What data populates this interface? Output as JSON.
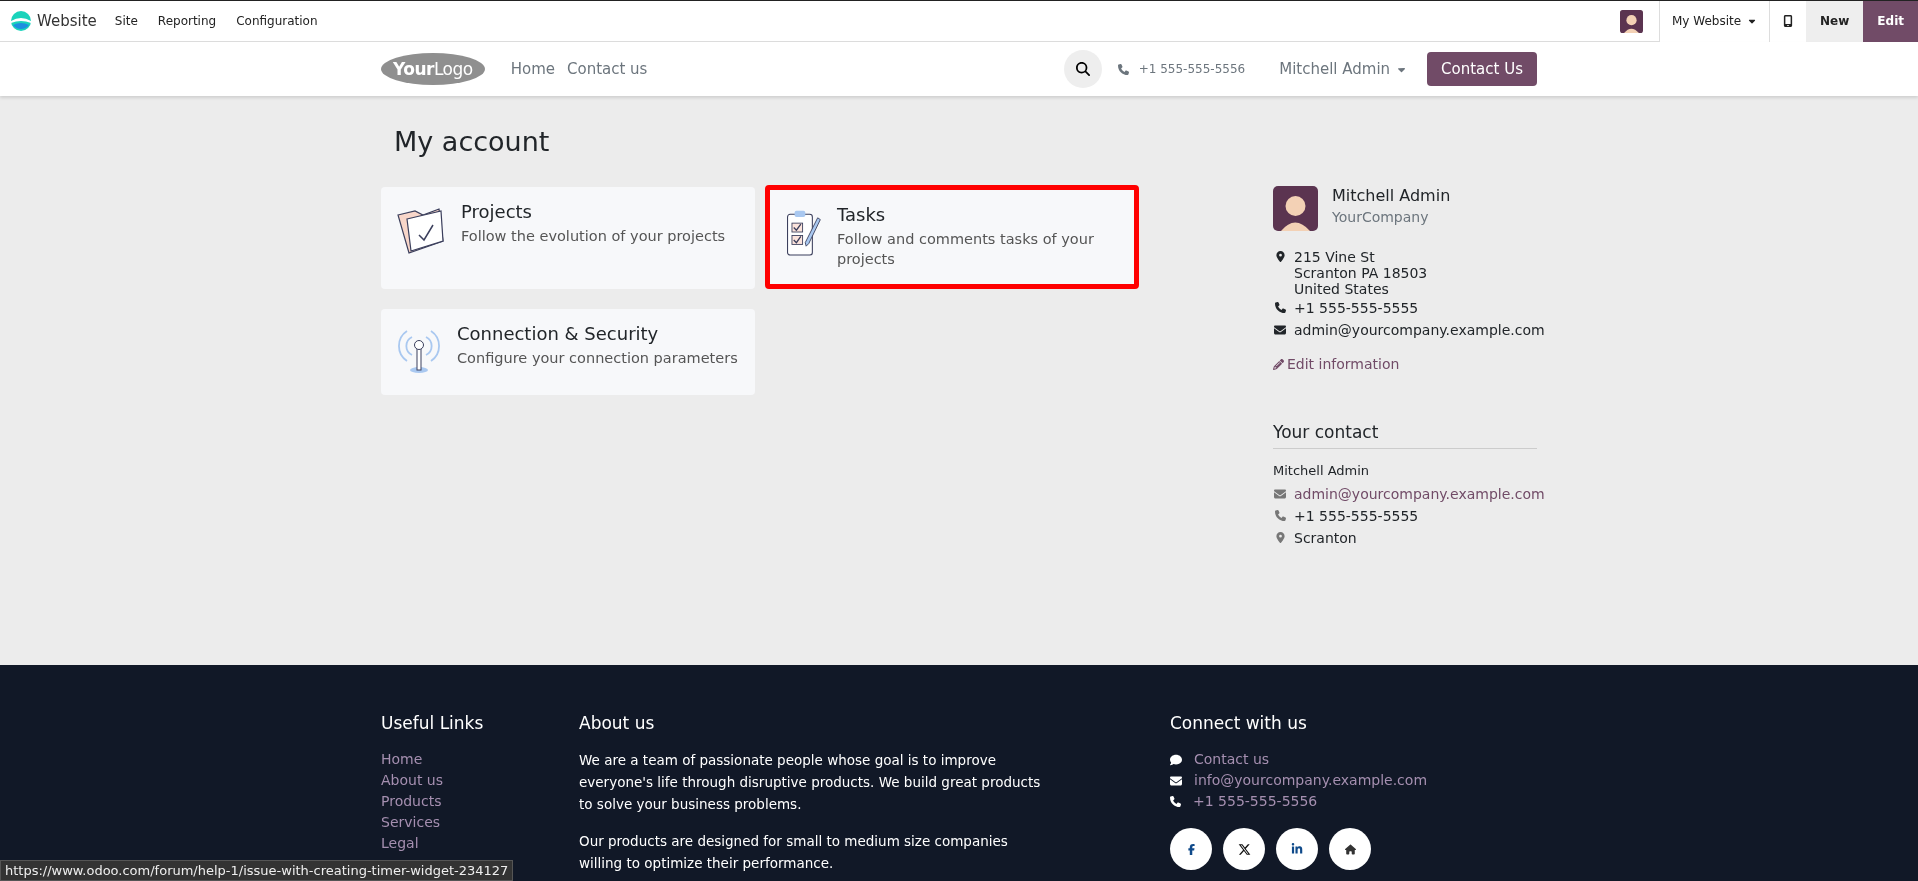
{
  "admin_bar": {
    "app_name": "Website",
    "menu": [
      "Site",
      "Reporting",
      "Configuration"
    ],
    "website_switch": "My Website",
    "new_button": "New",
    "edit_button": "Edit"
  },
  "header": {
    "logo": "**Your**Logo",
    "nav": [
      "Home",
      "Contact us"
    ],
    "phone": "+1 555-555-5556",
    "user": "Mitchell Admin",
    "cta": "Contact Us"
  },
  "page_title": "My account",
  "cards": [
    {
      "title": "Projects",
      "description": "Follow the evolution of your projects",
      "kind": "folder",
      "highlighted": false
    },
    {
      "title": "Tasks",
      "description": "Follow and comments tasks of your projects",
      "kind": "tasks",
      "highlighted": true
    },
    {
      "title": "Connection & Security",
      "description": "Configure your connection parameters",
      "kind": "antenna",
      "highlighted": false
    }
  ],
  "profile": {
    "name": "Mitchell Admin",
    "company": "YourCompany",
    "address": [
      "215 Vine St",
      "Scranton PA 18503",
      "United States"
    ],
    "phone": "+1 555-555-5555",
    "email": "admin@yourcompany.example.com",
    "edit_link": "Edit information"
  },
  "your_contact": {
    "title": "Your contact",
    "name": "Mitchell Admin",
    "email": "admin@yourcompany.example.com",
    "phone": "+1 555-555-5555",
    "city": "Scranton"
  },
  "footer": {
    "useful_links": {
      "title": "Useful Links",
      "links": [
        "Home",
        "About us",
        "Products",
        "Services",
        "Legal"
      ]
    },
    "about": {
      "title": "About us",
      "paragraphs": [
        "We are a team of passionate people whose goal is to improve everyone's life through disruptive products. We build great products to solve your business problems.",
        "Our products are designed for small to medium size companies willing to optimize their performance."
      ]
    },
    "connect": {
      "title": "Connect with us",
      "items": [
        {
          "kind": "chat",
          "text": "Contact us"
        },
        {
          "kind": "mail",
          "text": "info@yourcompany.example.com"
        },
        {
          "kind": "phone",
          "text": "+1 555-555-5556"
        }
      ],
      "social": [
        {
          "kind": "facebook"
        },
        {
          "kind": "x"
        },
        {
          "kind": "linkedin"
        },
        {
          "kind": "home"
        }
      ]
    }
  },
  "status_url": "https://www.odoo.com/forum/help-1/issue-with-creating-timer-widget-234127"
}
